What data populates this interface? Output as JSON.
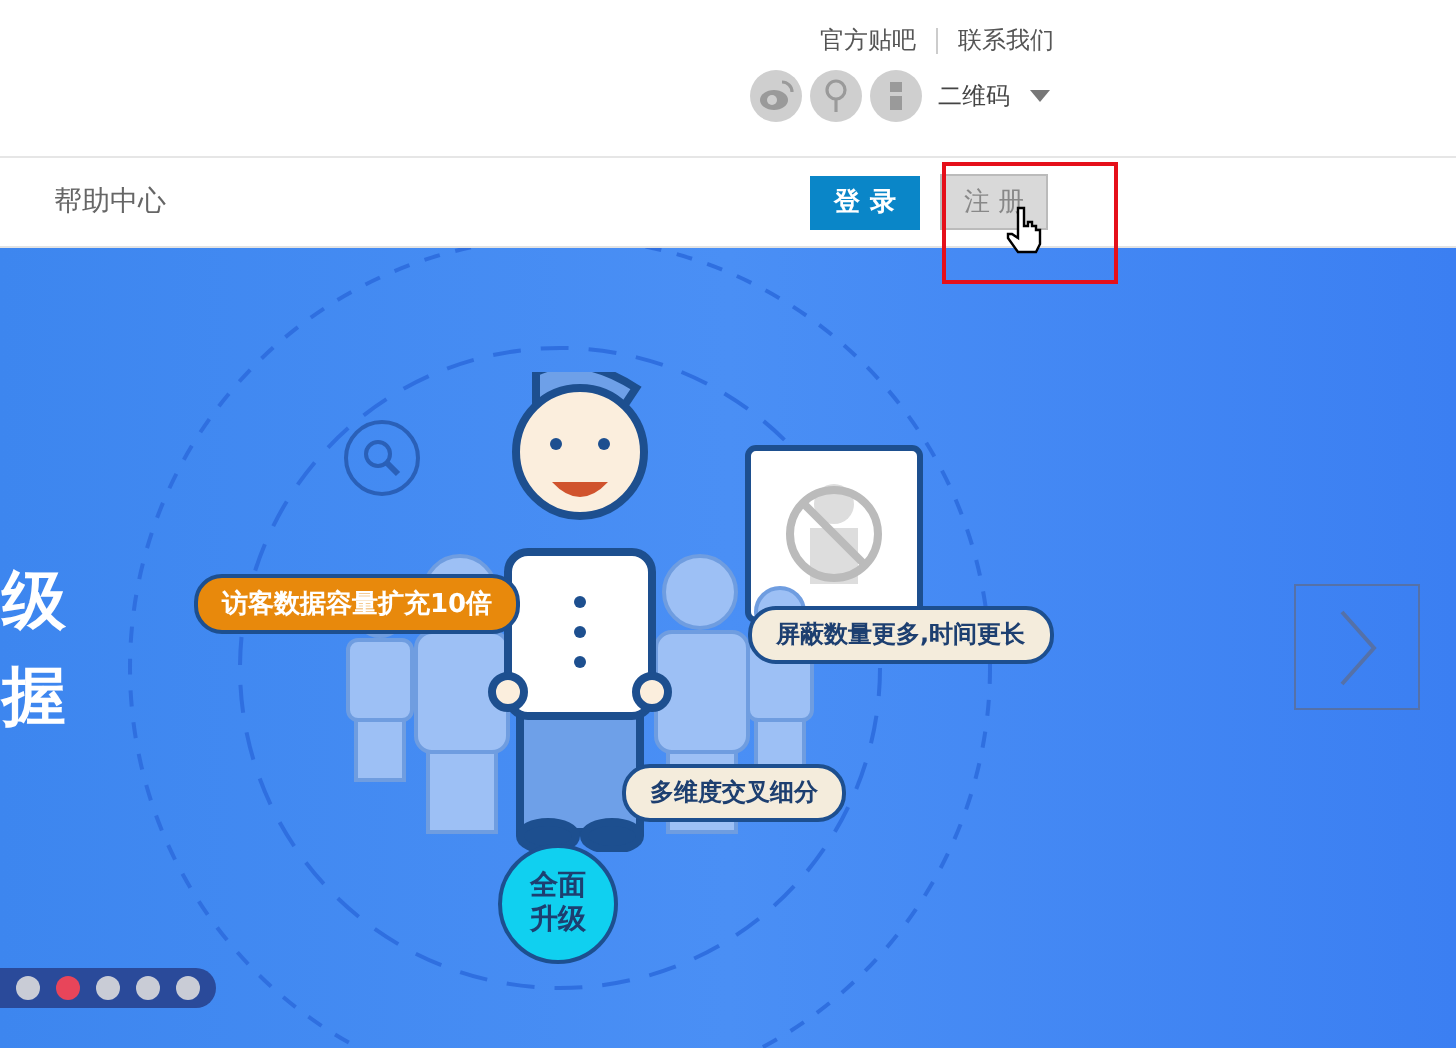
{
  "header": {
    "links": [
      {
        "text": "官方贴吧"
      },
      {
        "text": "联系我们"
      }
    ],
    "qr_label": "二维码"
  },
  "nav": {
    "help": "帮助中心",
    "login": "登 录",
    "register": "注 册",
    "register_highlighted": true
  },
  "banner": {
    "side_text": [
      "级",
      "握"
    ],
    "callouts": [
      {
        "kind": "orange",
        "text": "访客数据容量扩充10倍"
      },
      {
        "kind": "light",
        "text": "屏蔽数量更多,时间更长"
      },
      {
        "kind": "light",
        "text": "多维度交叉细分"
      }
    ],
    "badge": [
      "全面",
      "升级"
    ],
    "dots": [
      {
        "selected": false
      },
      {
        "selected": true
      },
      {
        "selected": false
      },
      {
        "selected": false
      },
      {
        "selected": false
      }
    ]
  }
}
